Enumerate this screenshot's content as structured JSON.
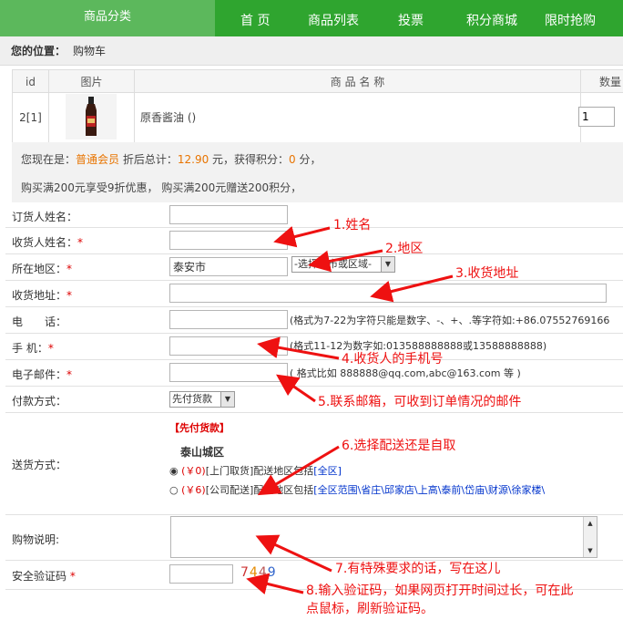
{
  "nav": {
    "category": "商品分类",
    "items": [
      "首 页",
      "商品列表",
      "投票",
      "积分商城",
      "限时抢购"
    ]
  },
  "breadcrumb": {
    "label": "您的位置：",
    "current": "购物车"
  },
  "cart": {
    "headers": [
      "id",
      "图片",
      "商 品 名 称",
      "数量"
    ],
    "row": {
      "id": "2[1]",
      "name": "原香酱油 ()",
      "qty": "1"
    }
  },
  "summary": {
    "pre": "您现在是：",
    "member": "普通会员",
    "mid": " 折后总计：",
    "total": "12.90",
    "post1": " 元，获得积分：",
    "points": "0",
    "post2": " 分，",
    "promo": "购买满200元享受9折优惠， 购买满200元赠送200积分，"
  },
  "form": {
    "orderer_label": "订货人姓名：",
    "receiver_label": "收货人姓名：",
    "region_label": "所在地区：",
    "region_value": "泰安市",
    "region_select": "-选择城市或区域-",
    "address_label": "收货地址：",
    "phone_label": "电　　话：",
    "phone_hint": "(格式为7-22为字符只能是数字、-、+、.等字符如:+86.07552769166",
    "mobile_label": "手 机：",
    "mobile_hint": "(格式11-12为数字如:013588888888或13588888888)",
    "email_label": "电子邮件：",
    "email_hint": "( 格式比如 888888@qq.com,abc@163.com 等 )",
    "payment_label": "付款方式：",
    "payment_value": "先付货款",
    "shipping_label": "送货方式：",
    "shipping_tag": "【先付货款】",
    "shipping_area": "泰山城区",
    "opt1_price": "(￥0)",
    "opt1_text": "[上门取货]配送地区包括",
    "opt1_link": "[全区]",
    "opt2_price": "(￥6)",
    "opt2_text": "[公司配送]配送地区包括",
    "opt2_links": "[全区范围\\省庄\\邱家店\\上高\\泰前\\岱庙\\财源\\徐家楼\\",
    "note_label": "购物说明:",
    "captcha_label": "安全验证码",
    "captcha_digits": [
      "7",
      "4",
      "4",
      "9"
    ]
  },
  "annotations": {
    "a1": "1.姓名",
    "a2": "2.地区",
    "a3": "3.收货地址",
    "a4": "4.收货人的手机号",
    "a5": "5.联系邮箱，可收到订单情况的邮件",
    "a6": "6.选择配送还是自取",
    "a7": "7.有特殊要求的话，写在这儿",
    "a8a": "8.输入验证码，如果网页打开时间过长，可在此",
    "a8b": "点鼠标，刷新验证码。"
  },
  "colors": {
    "nav_green": "#2fa52f",
    "annotation_red": "#ee1111",
    "member_orange": "#e87400"
  }
}
